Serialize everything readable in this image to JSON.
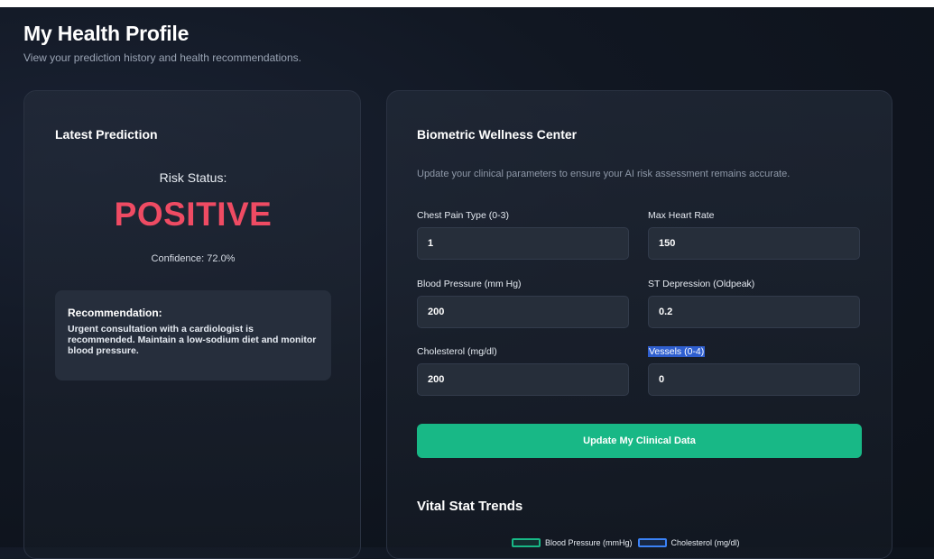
{
  "header": {
    "title": "My Health Profile",
    "subtitle": "View your prediction history and health recommendations."
  },
  "latest_prediction": {
    "heading": "Latest Prediction",
    "risk_label": "Risk Status:",
    "risk_value": "POSITIVE",
    "confidence": "Confidence: 72.0%",
    "recommendation_title": "Recommendation:",
    "recommendation_text": "Urgent consultation with a cardiologist is recommended. Maintain a low-sodium diet and monitor blood pressure."
  },
  "wellness": {
    "heading": "Biometric Wellness Center",
    "intro": "Update your clinical parameters to ensure your AI risk assessment remains accurate.",
    "fields": [
      {
        "label": "Chest Pain Type (0-3)",
        "value": "1"
      },
      {
        "label": "Max Heart Rate",
        "value": "150"
      },
      {
        "label": "Blood Pressure (mm Hg)",
        "value": "200"
      },
      {
        "label": "ST Depression (Oldpeak)",
        "value": "0.2"
      },
      {
        "label": "Cholesterol (mg/dl)",
        "value": "200"
      },
      {
        "label": "Vessels (0-4)",
        "value": "0"
      }
    ],
    "update_button": "Update My Clinical Data"
  },
  "trends": {
    "heading": "Vital Stat Trends",
    "legend": [
      {
        "label": "Blood Pressure (mmHg)",
        "color": "#18b886"
      },
      {
        "label": "Cholesterol (mg/dl)",
        "color": "#3b82f6"
      }
    ]
  },
  "colors": {
    "accent": "#18b886",
    "danger": "#ef4b63",
    "selection": "#2f5fcf"
  }
}
